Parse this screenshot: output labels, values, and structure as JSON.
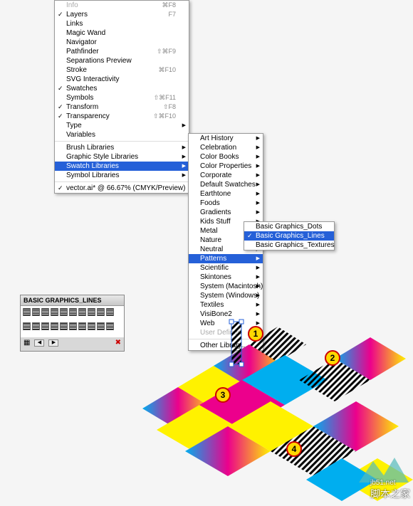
{
  "menu1": {
    "items": [
      {
        "label": "Info",
        "shortcut": "⌘F8",
        "disabled": true
      },
      {
        "label": "Layers",
        "shortcut": "F7",
        "checked": true
      },
      {
        "label": "Links"
      },
      {
        "label": "Magic Wand"
      },
      {
        "label": "Navigator"
      },
      {
        "label": "Pathfinder",
        "shortcut": "⇧⌘F9"
      },
      {
        "label": "Separations Preview"
      },
      {
        "label": "Stroke",
        "shortcut": "⌘F10"
      },
      {
        "label": "SVG Interactivity"
      },
      {
        "label": "Swatches",
        "checked": true
      },
      {
        "label": "Symbols",
        "shortcut": "⇧⌘F11"
      },
      {
        "label": "Transform",
        "shortcut": "⇧F8",
        "checked": true
      },
      {
        "label": "Transparency",
        "shortcut": "⇧⌘F10",
        "checked": true
      },
      {
        "label": "Type",
        "sub": true
      },
      {
        "label": "Variables"
      }
    ],
    "group2": [
      {
        "label": "Brush Libraries",
        "sub": true
      },
      {
        "label": "Graphic Style Libraries",
        "sub": true
      },
      {
        "label": "Swatch Libraries",
        "sub": true,
        "selected": true
      },
      {
        "label": "Symbol Libraries",
        "sub": true
      }
    ],
    "group3": [
      {
        "label": "vector.ai* @ 66.67% (CMYK/Preview)",
        "checked": true
      }
    ]
  },
  "menu2": {
    "items": [
      "Art History",
      "Celebration",
      "Color Books",
      "Color Properties",
      "Corporate",
      "Default Swatches",
      "Earthtone",
      "Foods",
      "Gradients",
      "Kids Stuff",
      "Metal",
      "Nature",
      "Neutral"
    ],
    "selected": "Patterns",
    "items2": [
      "Scientific",
      "Skintones",
      "System (Macintosh)",
      "System (Windows)",
      "Textiles",
      "VisiBone2",
      "Web"
    ],
    "disabled": "User Defined",
    "other": "Other Library..."
  },
  "menu3": {
    "items": [
      "Basic Graphics_Dots"
    ],
    "selected": "Basic Graphics_Lines",
    "items2": [
      "Basic Graphics_Textures"
    ]
  },
  "panel": {
    "title": "BASIC GRAPHICS_LINES"
  },
  "badges": [
    "1",
    "2",
    "3",
    "4"
  ],
  "watermark": {
    "url": "jb51.net",
    "cn": "脚本之家"
  }
}
